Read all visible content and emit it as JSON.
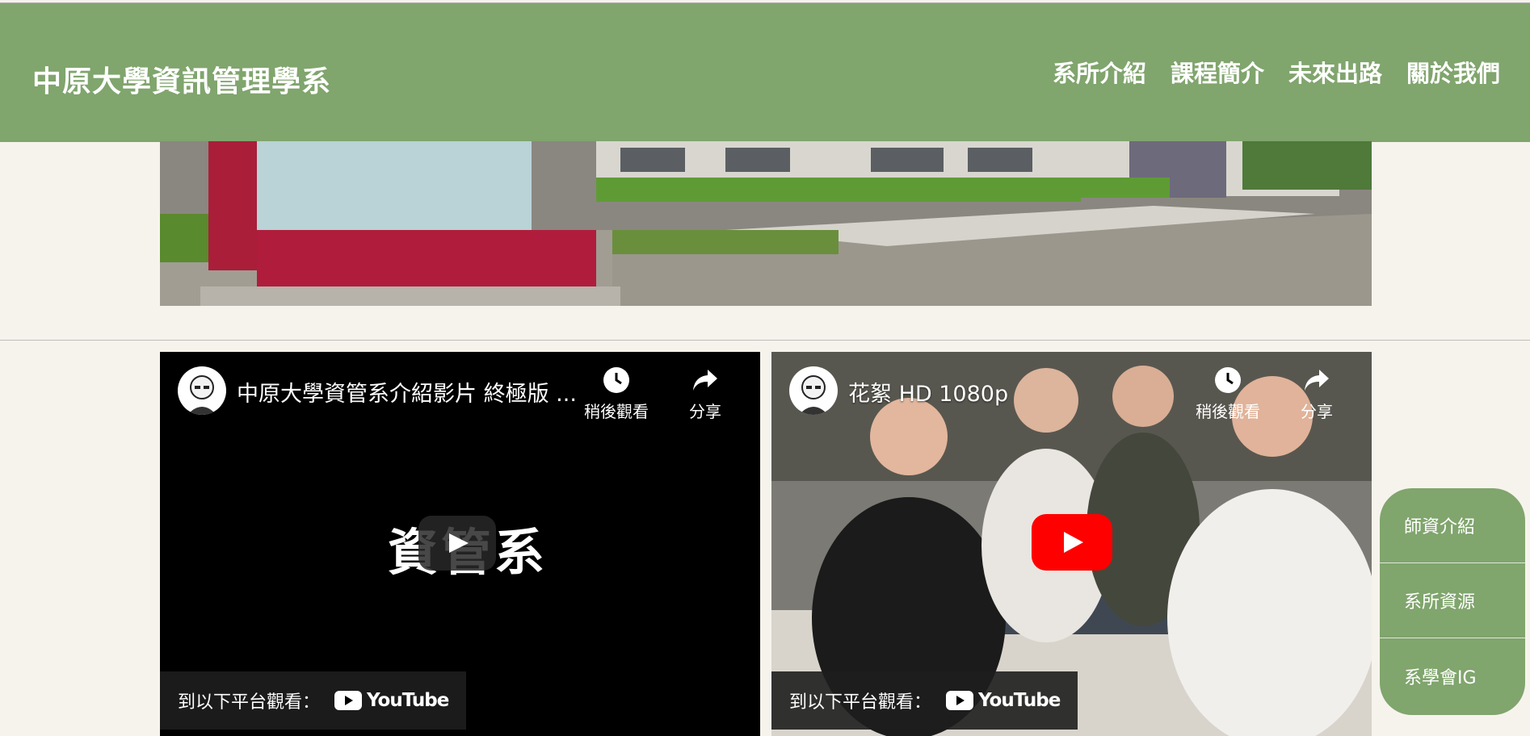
{
  "header": {
    "title": "中原大學資訊管理學系"
  },
  "nav": {
    "items": [
      {
        "label": "系所介紹"
      },
      {
        "label": "課程簡介"
      },
      {
        "label": "未來出路"
      },
      {
        "label": "關於我們"
      }
    ]
  },
  "videos": [
    {
      "title": "中原大學資管系介紹影片 終極版 ...",
      "watch_later": "稍後觀看",
      "share": "分享",
      "watch_on": "到以下平台觀看：",
      "platform": "YouTube",
      "cover_text": "資管系"
    },
    {
      "title": "花絮 HD 1080p",
      "watch_later": "稍後觀看",
      "share": "分享",
      "watch_on": "到以下平台觀看：",
      "platform": "YouTube"
    }
  ],
  "side_nav": {
    "items": [
      {
        "label": "師資介紹"
      },
      {
        "label": "系所資源"
      },
      {
        "label": "系學會IG"
      }
    ]
  },
  "colors": {
    "header": "#80a56d",
    "background": "#f6f3ec",
    "youtube_red": "#ff0000"
  }
}
